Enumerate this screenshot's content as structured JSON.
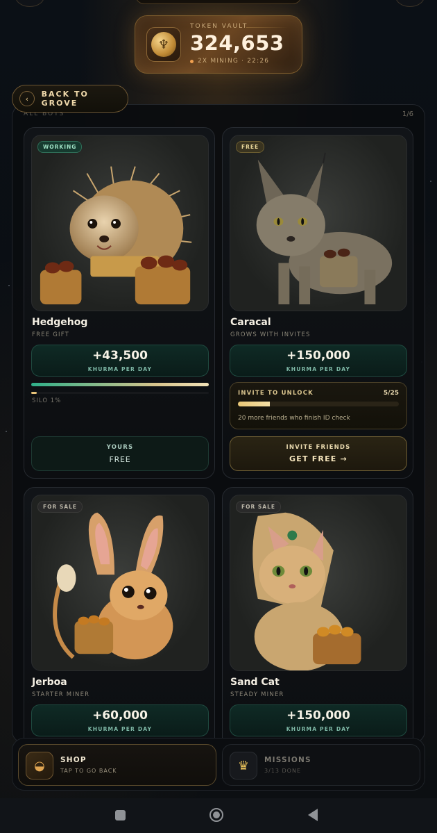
{
  "vault": {
    "label": "TOKEN VAULT",
    "value": "324,653",
    "mining": "2X MINING · 22:26"
  },
  "back_button": {
    "label": "BACK TO GROVE"
  },
  "panel": {
    "heading": "ALL BOTS",
    "count": "1/6"
  },
  "bots": [
    {
      "badge": "WORKING",
      "name": "Hedgehog",
      "subtitle": "FREE GIFT",
      "rate": "+43,500",
      "rate_unit": "KHURMA PER DAY",
      "work_progress": 1.0,
      "silo_fill": 0.01,
      "silo_label": "SILO 1%",
      "action_title": "YOURS",
      "action_label": "FREE"
    },
    {
      "badge": "FREE",
      "name": "Caracal",
      "subtitle": "GROWS WITH INVITES",
      "rate": "+150,000",
      "rate_unit": "KHURMA PER DAY",
      "invite_title": "INVITE TO UNLOCK",
      "invite_count": "5/25",
      "invite_progress": 0.2,
      "invite_desc": "20 more friends who finish ID check",
      "action_title": "INVITE FRIENDS",
      "action_label": "GET FREE →"
    },
    {
      "badge": "FOR SALE",
      "name": "Jerboa",
      "subtitle": "STARTER MINER",
      "rate": "+60,000",
      "rate_unit": "KHURMA PER DAY"
    },
    {
      "badge": "FOR SALE",
      "name": "Sand Cat",
      "subtitle": "STEADY MINER",
      "rate": "+150,000",
      "rate_unit": "KHURMA PER DAY"
    }
  ],
  "bottom_nav": {
    "shop": {
      "title": "SHOP",
      "subtitle": "TAP TO GO BACK",
      "icon": "date-basket-icon"
    },
    "missions": {
      "title": "MISSIONS",
      "subtitle": "3/13 DONE",
      "icon": "crown-icon"
    }
  },
  "colors": {
    "accent_gold": "#e8c47a",
    "accent_green": "#2fb08a",
    "background": "#07090c"
  }
}
